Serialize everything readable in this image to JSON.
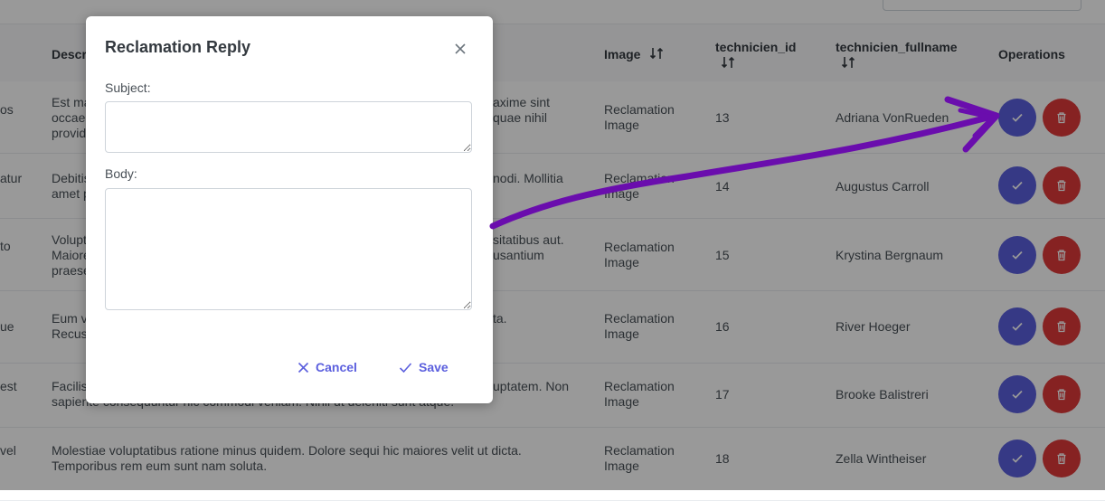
{
  "table": {
    "headers": {
      "description": "Descr",
      "image": "Image",
      "technicien_id": "technicien_id",
      "technicien_fullname": "technicien_fullname",
      "operations": "Operations"
    },
    "rows": [
      {
        "left": "os",
        "desc1": "Est ma",
        "desc2": "occae",
        "desc3": "provid",
        "desc_right1": "axime sint",
        "desc_right2": "quae nihil",
        "desc_right3": "",
        "image1": "Reclamation",
        "image2": "Image",
        "tech_id": "13",
        "fullname": "Adriana VonRueden"
      },
      {
        "left": "atur",
        "desc1": "Debitis",
        "desc2": "amet p",
        "desc3": "",
        "desc_right1": "nodi. Mollitia",
        "desc_right2": "",
        "desc_right3": "",
        "image1": "Reclamation",
        "image2": "Image",
        "tech_id": "14",
        "fullname": "Augustus Carroll"
      },
      {
        "left": "to",
        "desc1": "Volupt",
        "desc2": "Maiore",
        "desc3": "praese",
        "desc_right1": "sitatibus aut.",
        "desc_right2": "usantium",
        "desc_right3": "",
        "image1": "Reclamation",
        "image2": "Image",
        "tech_id": "15",
        "fullname": "Krystina Bergnaum"
      },
      {
        "left": "ue",
        "desc1": "Eum v",
        "desc2": "Recus",
        "desc3": "",
        "desc_right1": "ta.",
        "desc_right2": "",
        "desc_right3": "",
        "image1": "Reclamation",
        "image2": "Image",
        "tech_id": "16",
        "fullname": "River Hoeger"
      },
      {
        "left": "est",
        "desc1": "Facilis",
        "desc2": "sapiente consequuntur hic commodi veniam. Nihil ut deleniti sunt atque.",
        "desc3": "",
        "desc_right1": "uptatem. Non",
        "desc_right2": "",
        "desc_right3": "",
        "image1": "Reclamation",
        "image2": "Image",
        "tech_id": "17",
        "fullname": "Brooke Balistreri"
      },
      {
        "left": "vel",
        "desc1": "Molestiae voluptatibus ratione minus quidem. Dolore sequi hic maiores velit ut dicta.",
        "desc2": "Temporibus rem eum sunt nam soluta.",
        "desc3": "",
        "desc_right1": "",
        "desc_right2": "",
        "desc_right3": "",
        "image1": "Reclamation",
        "image2": "Image",
        "tech_id": "18",
        "fullname": "Zella Wintheiser"
      }
    ]
  },
  "dialog": {
    "title": "Reclamation Reply",
    "subject_label": "Subject:",
    "subject_value": "",
    "body_label": "Body:",
    "body_value": "",
    "cancel_label": "Cancel",
    "save_label": "Save"
  },
  "colors": {
    "accent": "#5b5fde",
    "danger": "#e03a3a",
    "annotation_arrow": "#6a0dad"
  },
  "icons": {
    "close": "close-icon",
    "check": "check-icon",
    "trash": "trash-icon",
    "sort": "sort-icon"
  }
}
